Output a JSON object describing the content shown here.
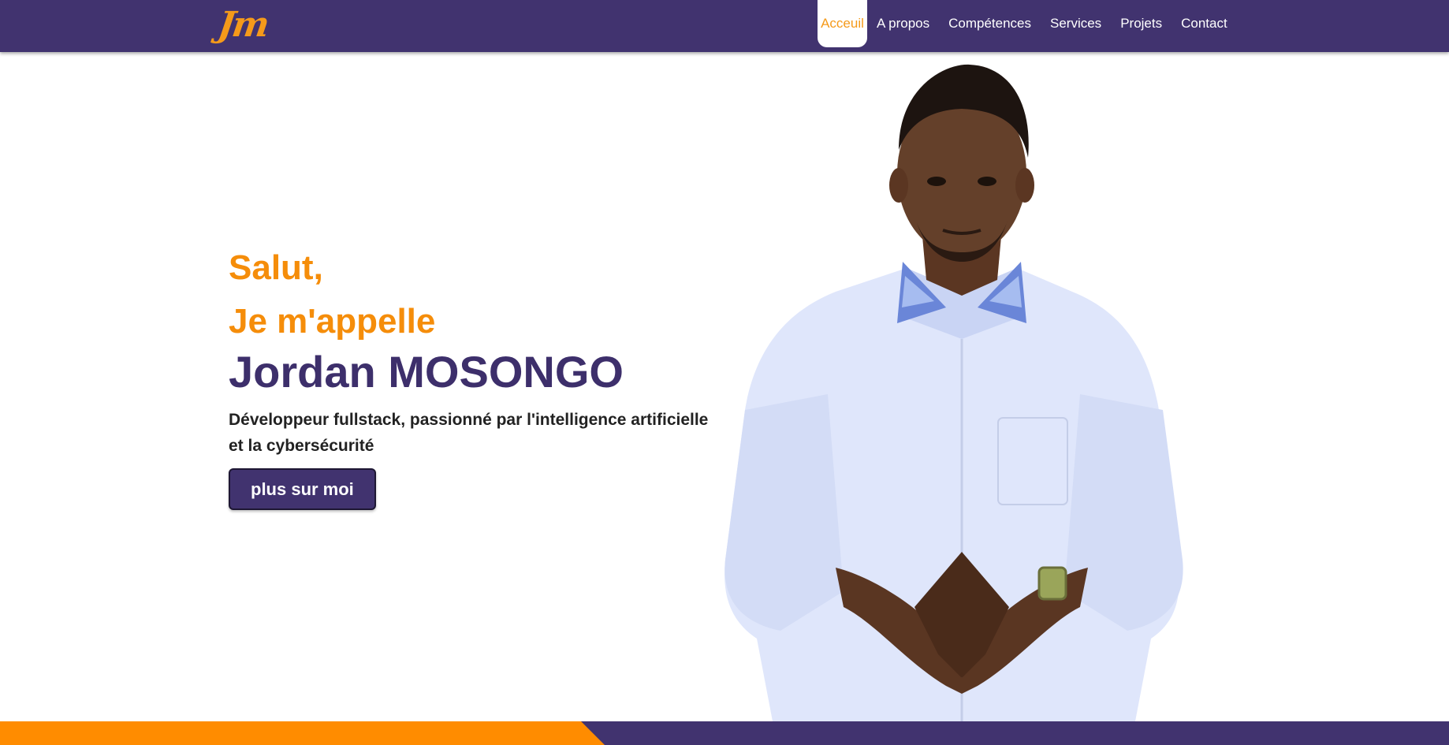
{
  "brand": {
    "logo": "Jm"
  },
  "nav": {
    "items": [
      {
        "label": "Acceuil",
        "active": true
      },
      {
        "label": "A propos"
      },
      {
        "label": "Compétences"
      },
      {
        "label": "Services"
      },
      {
        "label": "Projets"
      },
      {
        "label": "Contact"
      }
    ]
  },
  "hero": {
    "greeting_1": "Salut,",
    "greeting_2": "Je m'appelle",
    "name": "Jordan MOSONGO",
    "tagline": "Développeur fullstack, passionné par l'intelligence artificielle et la cybersécurité",
    "cta_label": "plus sur moi"
  },
  "colors": {
    "navbar": "#41336f",
    "accent": "#f58d0a",
    "name": "#3d2f6b",
    "band_left": "#ff8c00",
    "band_right": "#41336f"
  }
}
